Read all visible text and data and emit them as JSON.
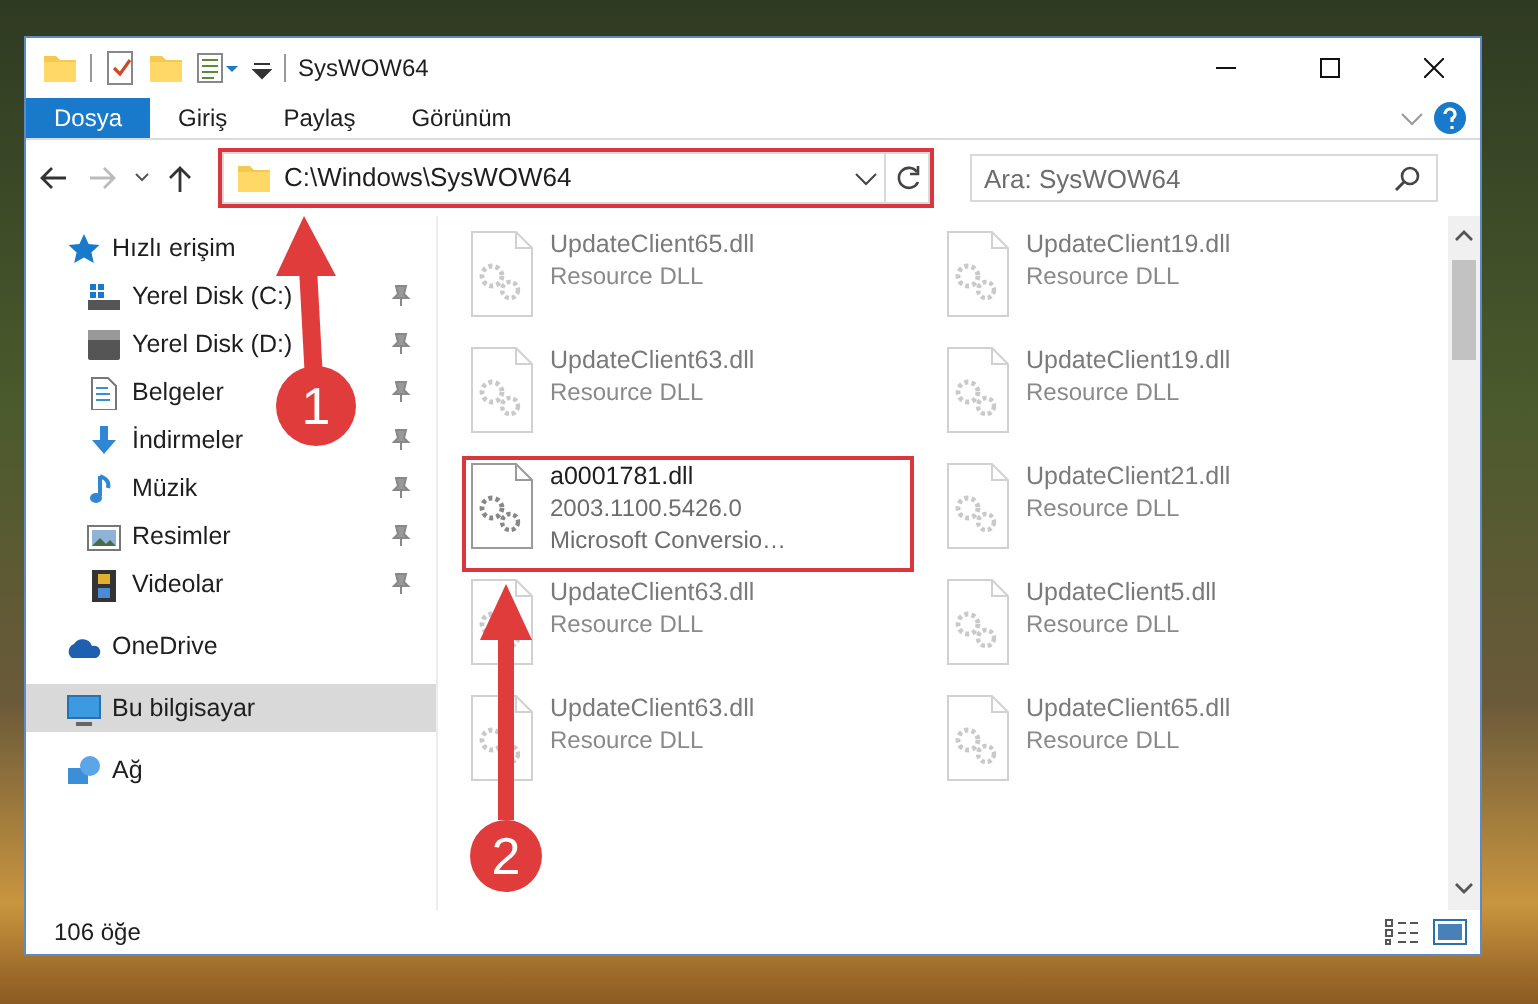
{
  "window": {
    "title": "SysWOW64"
  },
  "ribbon_tabs": [
    {
      "label": "Dosya",
      "selected": true
    },
    {
      "label": "Giriş",
      "selected": false
    },
    {
      "label": "Paylaş",
      "selected": false
    },
    {
      "label": "Görünüm",
      "selected": false
    }
  ],
  "address_bar": {
    "path": "C:\\Windows\\SysWOW64",
    "highlighted": true
  },
  "search": {
    "placeholder": "Ara: SysWOW64"
  },
  "sidebar": {
    "items": [
      {
        "label": "Hızlı erişim",
        "kind": "star",
        "selected": false,
        "children": [
          {
            "label": "Yerel Disk (C:)",
            "kind": "drive-windows",
            "pinned": true
          },
          {
            "label": "Yerel Disk (D:)",
            "kind": "drive",
            "pinned": true
          },
          {
            "label": "Belgeler",
            "kind": "document",
            "pinned": true
          },
          {
            "label": "İndirmeler",
            "kind": "download",
            "pinned": true
          },
          {
            "label": "Müzik",
            "kind": "music",
            "pinned": true
          },
          {
            "label": "Resimler",
            "kind": "picture",
            "pinned": true
          },
          {
            "label": "Videolar",
            "kind": "film",
            "pinned": true
          }
        ]
      },
      {
        "label": "OneDrive",
        "kind": "cloud",
        "selected": false
      },
      {
        "label": "Bu bilgisayar",
        "kind": "computer",
        "selected": true
      },
      {
        "label": "Ağ",
        "kind": "network",
        "selected": false
      }
    ]
  },
  "files": [
    {
      "name": "UpdateClient65.dll",
      "details": [
        "Resource DLL"
      ],
      "dimmed": true,
      "highlighted": false
    },
    {
      "name": "UpdateClient19.dll",
      "details": [
        "Resource DLL"
      ],
      "dimmed": true,
      "highlighted": false
    },
    {
      "name": "UpdateClient63.dll",
      "details": [
        "Resource DLL"
      ],
      "dimmed": true,
      "highlighted": false
    },
    {
      "name": "UpdateClient19.dll",
      "details": [
        "Resource DLL"
      ],
      "dimmed": true,
      "highlighted": false
    },
    {
      "name": "a0001781.dll",
      "details": [
        "2003.1100.5426.0",
        "Microsoft Conversio…"
      ],
      "dimmed": false,
      "highlighted": true
    },
    {
      "name": "UpdateClient21.dll",
      "details": [
        "Resource DLL"
      ],
      "dimmed": true,
      "highlighted": false
    },
    {
      "name": "UpdateClient63.dll",
      "details": [
        "Resource DLL"
      ],
      "dimmed": true,
      "highlighted": false
    },
    {
      "name": "UpdateClient5.dll",
      "details": [
        "Resource DLL"
      ],
      "dimmed": true,
      "highlighted": false
    },
    {
      "name": "UpdateClient63.dll",
      "details": [
        "Resource DLL"
      ],
      "dimmed": true,
      "highlighted": false
    },
    {
      "name": "UpdateClient65.dll",
      "details": [
        "Resource DLL"
      ],
      "dimmed": true,
      "highlighted": false
    }
  ],
  "status_bar": {
    "item_count": "106 öğe"
  },
  "callouts": [
    {
      "number": "1"
    },
    {
      "number": "2"
    }
  ]
}
